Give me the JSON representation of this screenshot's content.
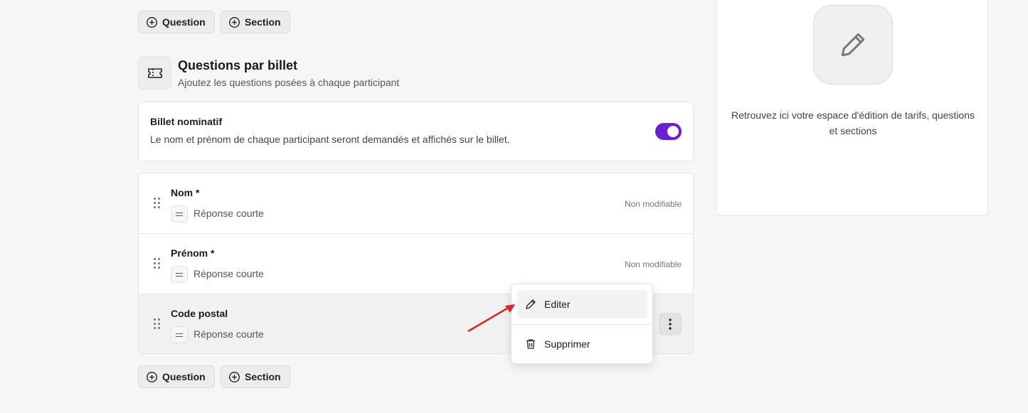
{
  "top_actions": {
    "question_label": "Question",
    "section_label": "Section"
  },
  "section": {
    "title": "Questions par billet",
    "subtitle": "Ajoutez les questions posées à chaque participant"
  },
  "nominatif": {
    "title": "Billet nominatif",
    "description": "Le nom et prénom de chaque participant seront demandés et affichés sur le billet.",
    "enabled": true
  },
  "questions": [
    {
      "label": "Nom *",
      "type": "Réponse courte",
      "status": "Non modifiable"
    },
    {
      "label": "Prénom *",
      "type": "Réponse courte",
      "status": "Non modifiable"
    },
    {
      "label": "Code postal",
      "type": "Réponse courte",
      "status": ""
    }
  ],
  "context_menu": {
    "edit_label": "Editer",
    "delete_label": "Supprimer"
  },
  "bottom_actions": {
    "question_label": "Question",
    "section_label": "Section"
  },
  "side_panel": {
    "text": "Retrouvez ici votre espace d'édition de tarifs, questions et sections"
  },
  "colors": {
    "accent": "#6a1fd4",
    "annotation_arrow": "#e02424"
  }
}
